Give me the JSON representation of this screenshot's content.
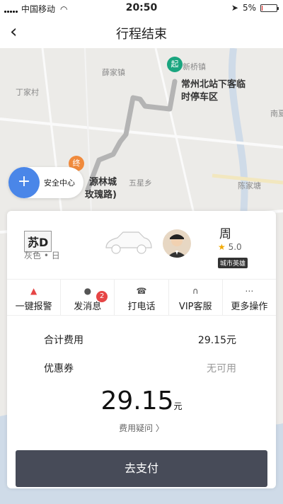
{
  "status_bar": {
    "carrier": "中国移动",
    "time": "20:50",
    "battery": "5%",
    "battery_level": 0.05
  },
  "nav": {
    "back_icon": "chevron-left",
    "title": "行程结束"
  },
  "map": {
    "labels": {
      "xinqiao": "新桥镇",
      "xuejia": "薛家镇",
      "dingjia": "丁家村",
      "nanxia": "南夏",
      "wuxing": "五星乡",
      "chenjia": "陈家塘",
      "dest_line1": "源林城",
      "dest_line2": "玫瑰路)",
      "station_line1": "常州北站下客临",
      "station_line2": "时停车区"
    },
    "start_pin": "起",
    "end_pin": "终",
    "safety_center": "安全中心"
  },
  "driver_card": {
    "plate": "苏D",
    "car_desc": "灰色 • 日",
    "driver_name": "周",
    "rating": "5.0",
    "badge": "城市英雄"
  },
  "actions": [
    {
      "label": "一键报警",
      "icon": "alarm-icon"
    },
    {
      "label": "发消息",
      "icon": "message-icon",
      "badge": "2"
    },
    {
      "label": "打电话",
      "icon": "phone-icon"
    },
    {
      "label": "VIP客服",
      "icon": "headset-icon"
    },
    {
      "label": "更多操作",
      "icon": "more-icon"
    }
  ],
  "fees": {
    "total_label": "合计费用",
    "total_value": "29.15元",
    "coupon_label": "优惠券",
    "coupon_value": "无可用",
    "amount": "29.15",
    "unit": "元",
    "question": "费用疑问 〉"
  },
  "pay_button": "去支付",
  "colors": {
    "route": "#b4b4b4",
    "start": "#1aa57f",
    "end": "#f08a3c",
    "pay": "#474b58",
    "badge": "#e64545",
    "safety": "#4a86e8"
  }
}
